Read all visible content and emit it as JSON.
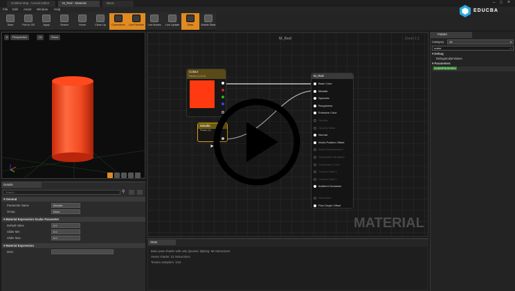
{
  "tabs": [
    "Untitled Map - Unreal Editor",
    "M_Red - Material",
    "Basic"
  ],
  "menu": [
    "File",
    "Edit",
    "Asset",
    "Window",
    "Help"
  ],
  "toolbar": [
    {
      "label": "Save",
      "active": false
    },
    {
      "label": "Find in CB",
      "active": false
    },
    {
      "label": "Apply",
      "active": false
    },
    {
      "label": "Search",
      "active": false
    },
    {
      "label": "Home",
      "active": false
    },
    {
      "label": "Clean Up",
      "active": false
    },
    {
      "label": "Connectors",
      "active": true
    },
    {
      "label": "Live Preview",
      "active": true
    },
    {
      "label": "Live Nodes",
      "active": false
    },
    {
      "label": "Live Update",
      "active": false
    },
    {
      "label": "Stats",
      "active": true
    },
    {
      "label": "Mobile Stats",
      "active": false
    }
  ],
  "viewport": {
    "buttons": [
      "Perspective",
      "Lit",
      "Show"
    ]
  },
  "details": {
    "tab": "Details",
    "search_placeholder": "Search",
    "sections": [
      {
        "title": "General",
        "rows": [
          {
            "label": "Parameter Name",
            "value": "Metallic"
          },
          {
            "label": "Group",
            "value": "None"
          }
        ]
      },
      {
        "title": "Material Expression Scalar Parameter",
        "rows": [
          {
            "label": "Default Value",
            "value": "0.0"
          },
          {
            "label": "Slider Min",
            "value": "0.0"
          },
          {
            "label": "Slider Max",
            "value": "0.0"
          }
        ]
      },
      {
        "title": "Material Expression",
        "rows": [
          {
            "label": "Desc",
            "value": ""
          }
        ]
      }
    ]
  },
  "graph": {
    "title": "M_Red",
    "zoom": "Zoom 1:1",
    "watermark": "MATERIAL",
    "color_node": {
      "title": "Colour",
      "subtitle": "Param (1,0,0,0)"
    },
    "metallic_node": {
      "title": "Metallic",
      "subtitle": "Param (0)"
    },
    "result_node": {
      "title": "M_Red",
      "pins": [
        {
          "label": "Base Color",
          "on": true
        },
        {
          "label": "Metallic",
          "on": true
        },
        {
          "label": "Specular",
          "on": true
        },
        {
          "label": "Roughness",
          "on": true
        },
        {
          "label": "Emissive Color",
          "on": true
        },
        {
          "label": "Opacity",
          "on": false
        },
        {
          "label": "Opacity Mask",
          "on": false
        },
        {
          "label": "Normal",
          "on": true
        },
        {
          "label": "World Position Offset",
          "on": true
        },
        {
          "label": "World Displacement",
          "on": false
        },
        {
          "label": "Tessellation Multiplier",
          "on": false
        },
        {
          "label": "Subsurface Color",
          "on": false
        },
        {
          "label": "Custom Data 0",
          "on": false
        },
        {
          "label": "Custom Data 1",
          "on": false
        },
        {
          "label": "Ambient Occlusion",
          "on": true
        },
        {
          "label": "Refraction",
          "on": false
        },
        {
          "label": "Pixel Depth Offset",
          "on": true
        }
      ]
    }
  },
  "stats": {
    "tab": "Stats",
    "lines": [
      "Base pass shader with only dynamic lighting: 68 instructions",
      "Vertex shader: 31 instructions",
      "Texture samplers: 1/16"
    ]
  },
  "palette": {
    "tab": "Palette",
    "category_label": "Category",
    "category_value": "All",
    "search_value": "scalar",
    "groups": [
      {
        "name": "Debug",
        "items": [
          "DebugScalarValues"
        ]
      },
      {
        "name": "Parameters",
        "items": [
          "ScalarParameter"
        ]
      }
    ]
  },
  "logo_text": "EDUCBA",
  "colors": {
    "accent": "#e08a22",
    "material_red": "#ff3a10",
    "selection": "#e0a010"
  }
}
